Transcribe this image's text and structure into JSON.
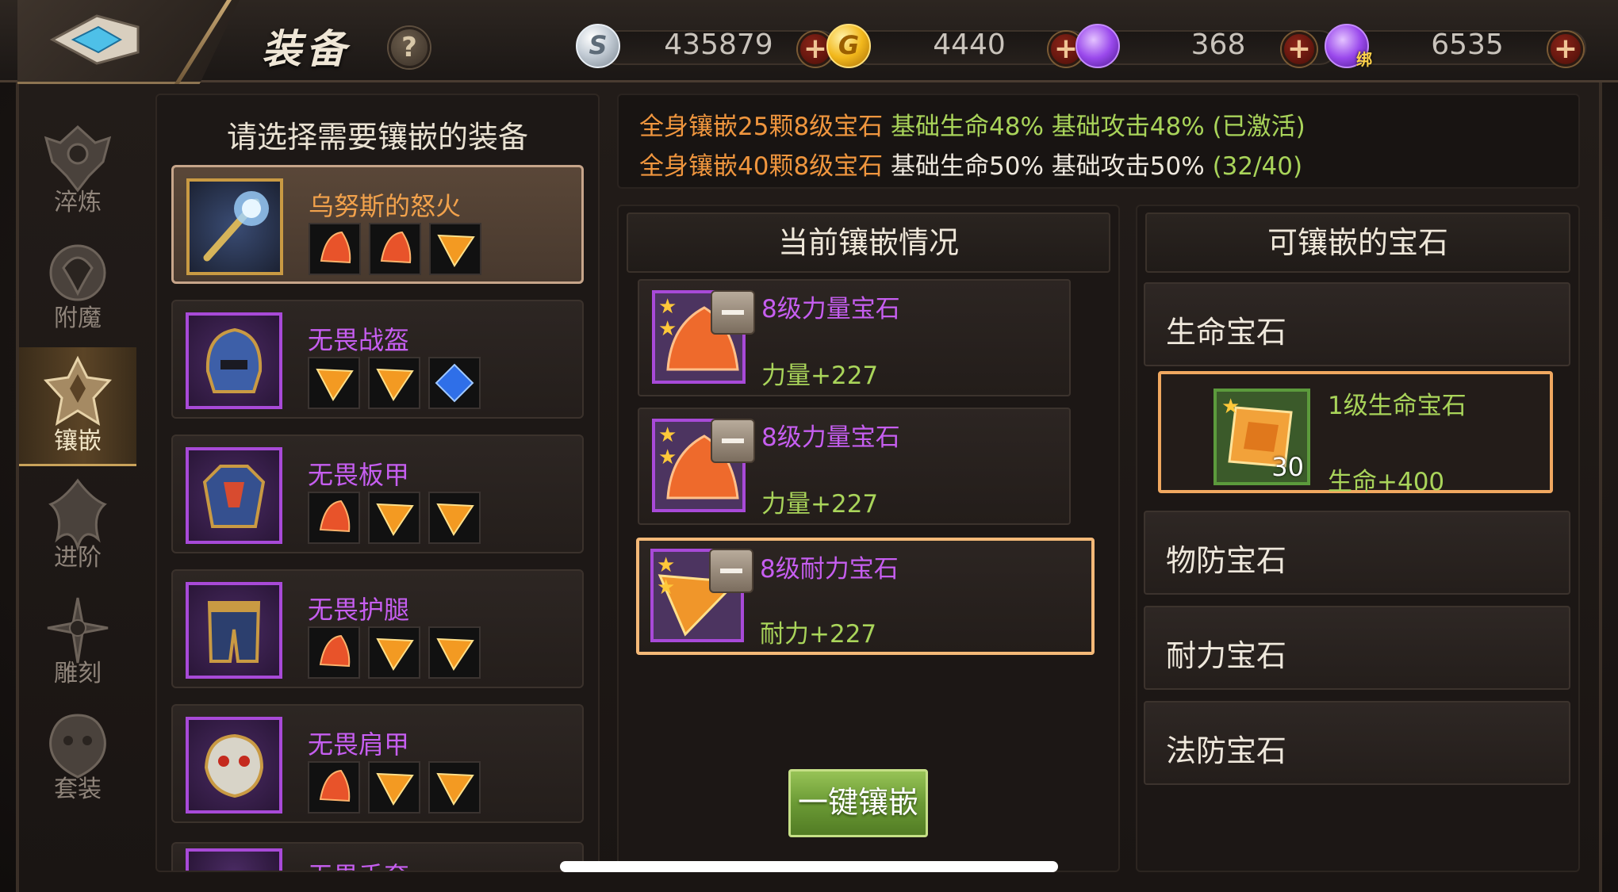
{
  "header": {
    "title": "装备",
    "help_label": "?",
    "currencies": [
      {
        "icon": "silver-coin-icon",
        "value": "435879"
      },
      {
        "icon": "gold-coin-icon",
        "value": "4440"
      },
      {
        "icon": "purple-gem-icon",
        "value": "368"
      },
      {
        "icon": "bound-purple-gem-icon",
        "value": "6535",
        "tag": "绑"
      }
    ],
    "plus_label": "+"
  },
  "nav": {
    "items": [
      {
        "label": "淬炼",
        "icon": "temper-emblem-icon"
      },
      {
        "label": "附魔",
        "icon": "enchant-emblem-icon"
      },
      {
        "label": "镶嵌",
        "icon": "inlay-emblem-icon",
        "active": true
      },
      {
        "label": "进阶",
        "icon": "advance-emblem-icon"
      },
      {
        "label": "雕刻",
        "icon": "engrave-emblem-icon"
      },
      {
        "label": "套装",
        "icon": "set-emblem-icon"
      }
    ]
  },
  "equipment": {
    "title": "请选择需要镶嵌的装备",
    "items": [
      {
        "name": "乌努斯的怒火",
        "sockets": [
          "red",
          "red",
          "orange"
        ],
        "selected": true
      },
      {
        "name": "无畏战盔",
        "sockets": [
          "orange",
          "orange",
          "blue"
        ]
      },
      {
        "name": "无畏板甲",
        "sockets": [
          "red",
          "orange",
          "orange"
        ]
      },
      {
        "name": "无畏护腿",
        "sockets": [
          "red",
          "orange",
          "orange"
        ]
      },
      {
        "name": "无畏肩甲",
        "sockets": [
          "red",
          "orange",
          "orange"
        ]
      },
      {
        "name": "无畏手套"
      }
    ]
  },
  "bonus": {
    "line1": {
      "requirement": "全身镶嵌25颗8级宝石",
      "effect": "基础生命48% 基础攻击48% (已激活)"
    },
    "line2": {
      "requirement": "全身镶嵌40颗8级宝石",
      "effect": "基础生命50% 基础攻击50%",
      "progress": "(32/40)"
    }
  },
  "current": {
    "title": "当前镶嵌情况",
    "gems": [
      {
        "name": "8级力量宝石",
        "stat": "力量+227",
        "stars": 2
      },
      {
        "name": "8级力量宝石",
        "stat": "力量+227",
        "stars": 2
      },
      {
        "name": "8级耐力宝石",
        "stat": "耐力+227",
        "stars": 2,
        "highlight": true
      }
    ],
    "one_click_label": "一键镶嵌"
  },
  "available": {
    "title": "可镶嵌的宝石",
    "categories": [
      "生命宝石",
      "物防宝石",
      "耐力宝石",
      "法防宝石"
    ],
    "gem": {
      "name": "1级生命宝石",
      "stat": "生命+400",
      "quantity": "30",
      "stars": 1
    }
  },
  "colors": {
    "accent_orange": "#f0963e",
    "accent_green": "#a9d45a",
    "epic_purple": "#c65ef0",
    "legendary_orange": "#f2a24c"
  }
}
